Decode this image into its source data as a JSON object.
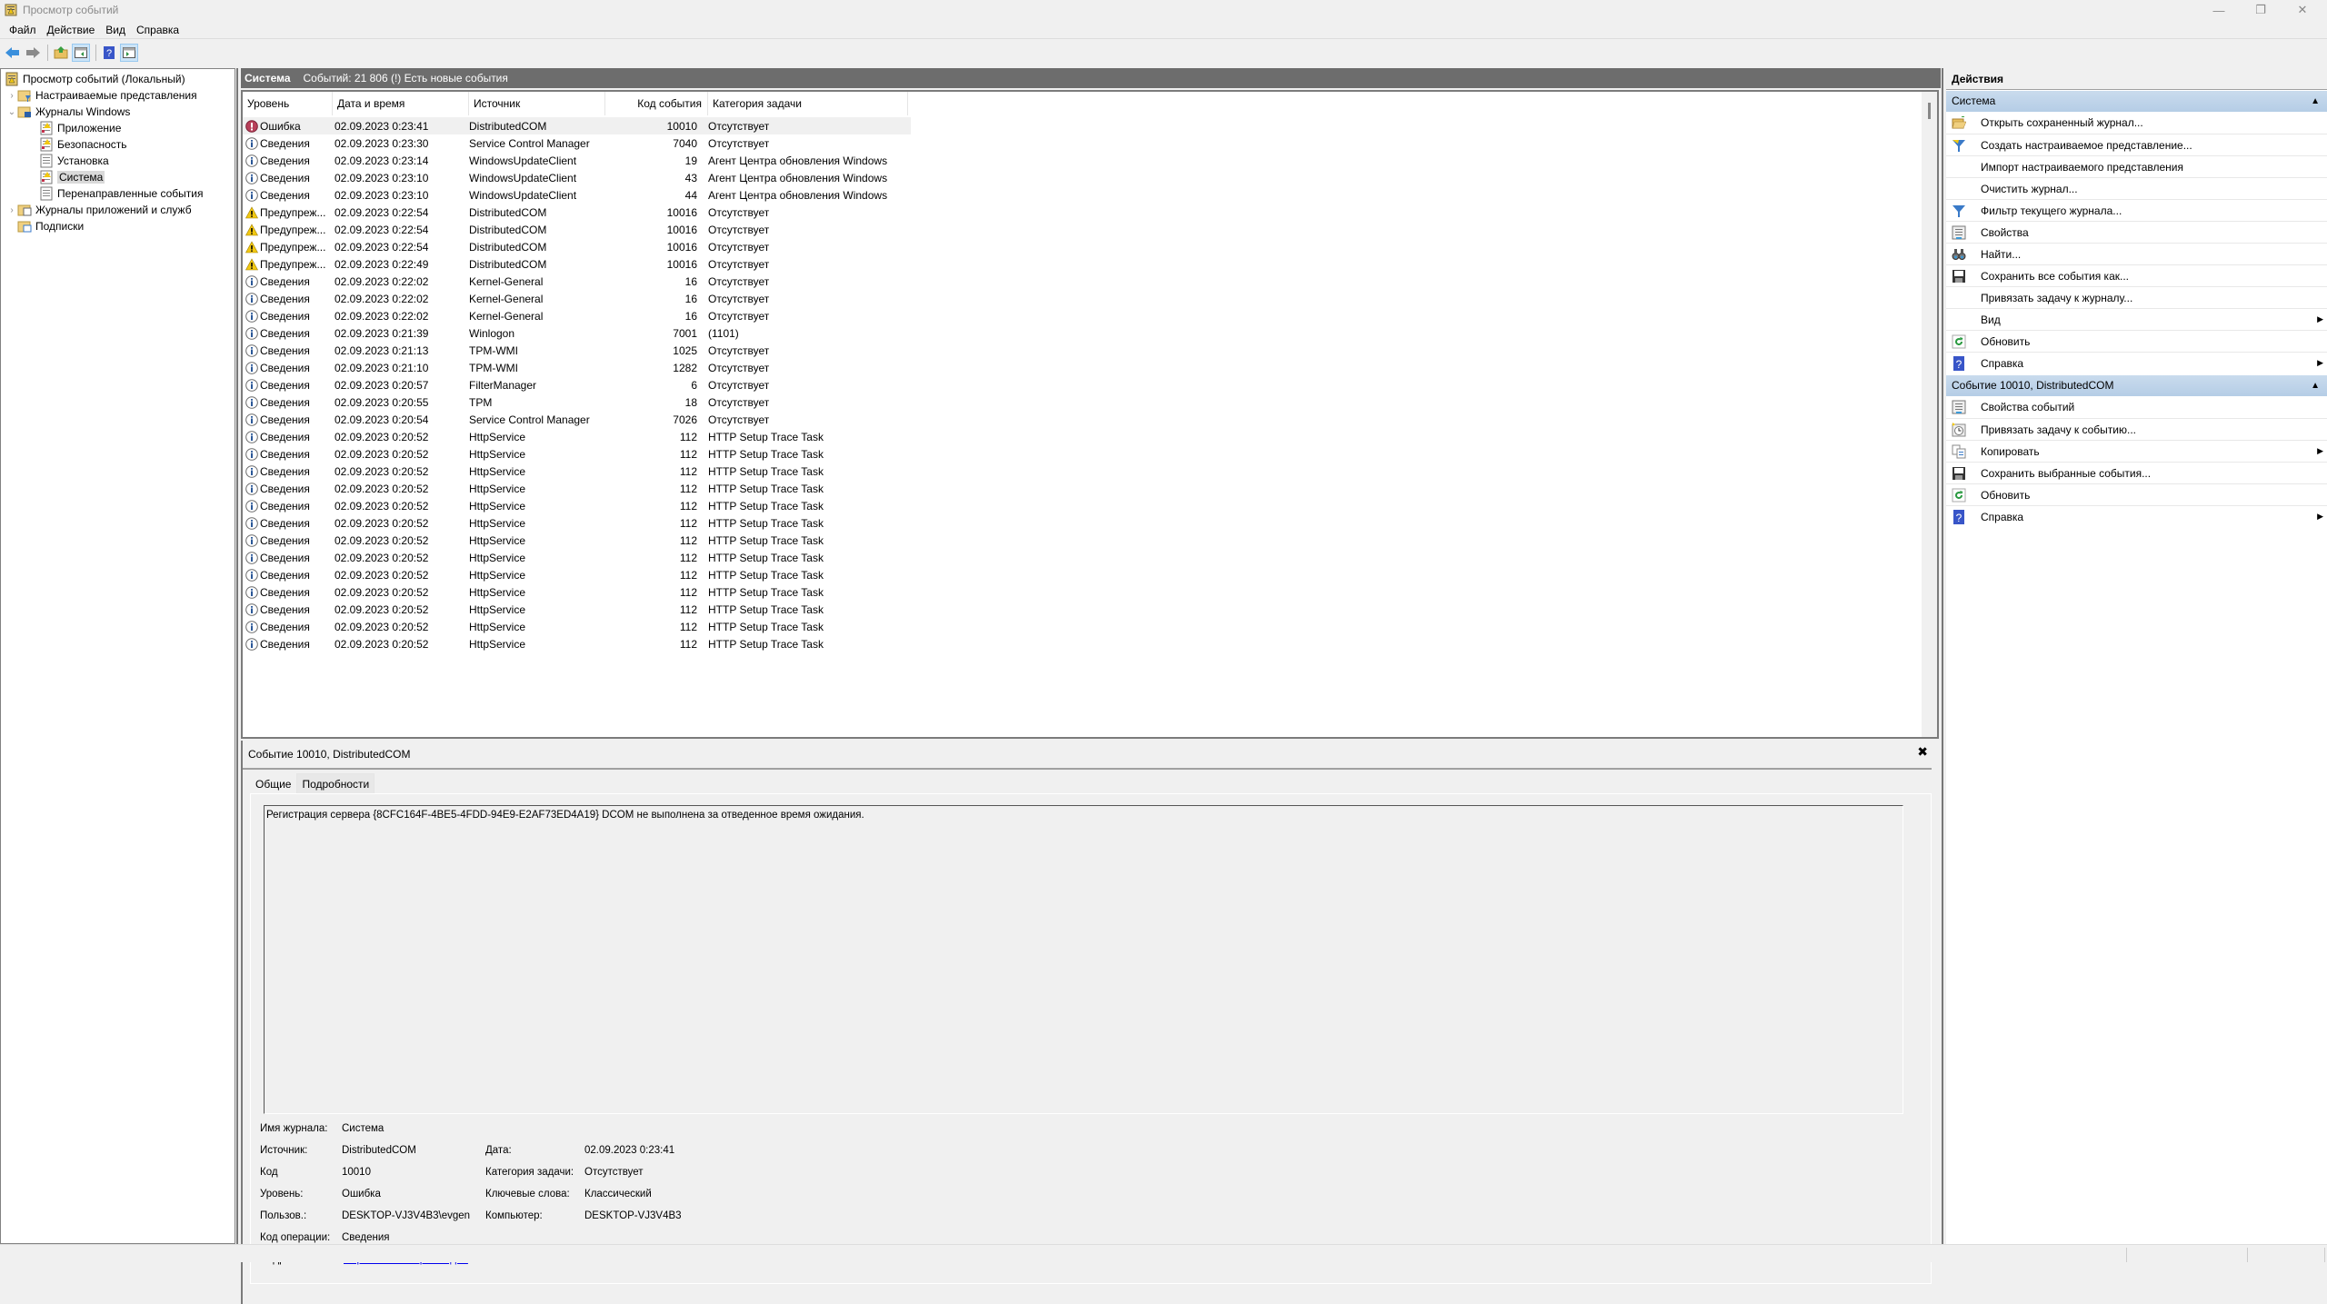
{
  "window": {
    "title": "Просмотр событий",
    "controls": {
      "minimize": "—",
      "maximize": "❐",
      "close": "✕"
    }
  },
  "menu": [
    "Файл",
    "Действие",
    "Вид",
    "Справка"
  ],
  "toolbar": {
    "buttons": [
      "back-icon",
      "forward-icon",
      "up-folder-icon",
      "show-hide-console-tree-icon",
      "help-icon",
      "show-hide-action-pane-icon"
    ]
  },
  "tree": {
    "root": "Просмотр событий (Локальный)",
    "items": [
      {
        "label": "Настраиваемые представления",
        "level": 1,
        "expander": "›"
      },
      {
        "label": "Журналы Windows",
        "level": 1,
        "expander": "⌄"
      },
      {
        "label": "Приложение",
        "level": 2
      },
      {
        "label": "Безопасность",
        "level": 2
      },
      {
        "label": "Установка",
        "level": 2
      },
      {
        "label": "Система",
        "level": 2,
        "selected": true
      },
      {
        "label": "Перенаправленные события",
        "level": 2
      },
      {
        "label": "Журналы приложений и служб",
        "level": 1,
        "expander": "›"
      },
      {
        "label": "Подписки",
        "level": 1
      }
    ]
  },
  "list": {
    "title": "Система",
    "summary": "Событий: 21 806 (!) Есть новые события",
    "columns": [
      "Уровень",
      "Дата и время",
      "Источник",
      "Код события",
      "Категория задачи"
    ],
    "rows": [
      {
        "level": "Ошибка",
        "type": "error",
        "date": "02.09.2023 0:23:41",
        "source": "DistributedCOM",
        "code": "10010",
        "category": "Отсутствует"
      },
      {
        "level": "Сведения",
        "type": "info",
        "date": "02.09.2023 0:23:30",
        "source": "Service Control Manager",
        "code": "7040",
        "category": "Отсутствует"
      },
      {
        "level": "Сведения",
        "type": "info",
        "date": "02.09.2023 0:23:14",
        "source": "WindowsUpdateClient",
        "code": "19",
        "category": "Агент Центра обновления Windows"
      },
      {
        "level": "Сведения",
        "type": "info",
        "date": "02.09.2023 0:23:10",
        "source": "WindowsUpdateClient",
        "code": "43",
        "category": "Агент Центра обновления Windows"
      },
      {
        "level": "Сведения",
        "type": "info",
        "date": "02.09.2023 0:23:10",
        "source": "WindowsUpdateClient",
        "code": "44",
        "category": "Агент Центра обновления Windows"
      },
      {
        "level": "Предупреж...",
        "type": "warning",
        "date": "02.09.2023 0:22:54",
        "source": "DistributedCOM",
        "code": "10016",
        "category": "Отсутствует"
      },
      {
        "level": "Предупреж...",
        "type": "warning",
        "date": "02.09.2023 0:22:54",
        "source": "DistributedCOM",
        "code": "10016",
        "category": "Отсутствует"
      },
      {
        "level": "Предупреж...",
        "type": "warning",
        "date": "02.09.2023 0:22:54",
        "source": "DistributedCOM",
        "code": "10016",
        "category": "Отсутствует"
      },
      {
        "level": "Предупреж...",
        "type": "warning",
        "date": "02.09.2023 0:22:49",
        "source": "DistributedCOM",
        "code": "10016",
        "category": "Отсутствует"
      },
      {
        "level": "Сведения",
        "type": "info",
        "date": "02.09.2023 0:22:02",
        "source": "Kernel-General",
        "code": "16",
        "category": "Отсутствует"
      },
      {
        "level": "Сведения",
        "type": "info",
        "date": "02.09.2023 0:22:02",
        "source": "Kernel-General",
        "code": "16",
        "category": "Отсутствует"
      },
      {
        "level": "Сведения",
        "type": "info",
        "date": "02.09.2023 0:22:02",
        "source": "Kernel-General",
        "code": "16",
        "category": "Отсутствует"
      },
      {
        "level": "Сведения",
        "type": "info",
        "date": "02.09.2023 0:21:39",
        "source": "Winlogon",
        "code": "7001",
        "category": "(1101)"
      },
      {
        "level": "Сведения",
        "type": "info",
        "date": "02.09.2023 0:21:13",
        "source": "TPM-WMI",
        "code": "1025",
        "category": "Отсутствует"
      },
      {
        "level": "Сведения",
        "type": "info",
        "date": "02.09.2023 0:21:10",
        "source": "TPM-WMI",
        "code": "1282",
        "category": "Отсутствует"
      },
      {
        "level": "Сведения",
        "type": "info",
        "date": "02.09.2023 0:20:57",
        "source": "FilterManager",
        "code": "6",
        "category": "Отсутствует"
      },
      {
        "level": "Сведения",
        "type": "info",
        "date": "02.09.2023 0:20:55",
        "source": "TPM",
        "code": "18",
        "category": "Отсутствует"
      },
      {
        "level": "Сведения",
        "type": "info",
        "date": "02.09.2023 0:20:54",
        "source": "Service Control Manager",
        "code": "7026",
        "category": "Отсутствует"
      },
      {
        "level": "Сведения",
        "type": "info",
        "date": "02.09.2023 0:20:52",
        "source": "HttpService",
        "code": "112",
        "category": "HTTP Setup Trace Task"
      },
      {
        "level": "Сведения",
        "type": "info",
        "date": "02.09.2023 0:20:52",
        "source": "HttpService",
        "code": "112",
        "category": "HTTP Setup Trace Task"
      },
      {
        "level": "Сведения",
        "type": "info",
        "date": "02.09.2023 0:20:52",
        "source": "HttpService",
        "code": "112",
        "category": "HTTP Setup Trace Task"
      },
      {
        "level": "Сведения",
        "type": "info",
        "date": "02.09.2023 0:20:52",
        "source": "HttpService",
        "code": "112",
        "category": "HTTP Setup Trace Task"
      },
      {
        "level": "Сведения",
        "type": "info",
        "date": "02.09.2023 0:20:52",
        "source": "HttpService",
        "code": "112",
        "category": "HTTP Setup Trace Task"
      },
      {
        "level": "Сведения",
        "type": "info",
        "date": "02.09.2023 0:20:52",
        "source": "HttpService",
        "code": "112",
        "category": "HTTP Setup Trace Task"
      },
      {
        "level": "Сведения",
        "type": "info",
        "date": "02.09.2023 0:20:52",
        "source": "HttpService",
        "code": "112",
        "category": "HTTP Setup Trace Task"
      },
      {
        "level": "Сведения",
        "type": "info",
        "date": "02.09.2023 0:20:52",
        "source": "HttpService",
        "code": "112",
        "category": "HTTP Setup Trace Task"
      },
      {
        "level": "Сведения",
        "type": "info",
        "date": "02.09.2023 0:20:52",
        "source": "HttpService",
        "code": "112",
        "category": "HTTP Setup Trace Task"
      },
      {
        "level": "Сведения",
        "type": "info",
        "date": "02.09.2023 0:20:52",
        "source": "HttpService",
        "code": "112",
        "category": "HTTP Setup Trace Task"
      },
      {
        "level": "Сведения",
        "type": "info",
        "date": "02.09.2023 0:20:52",
        "source": "HttpService",
        "code": "112",
        "category": "HTTP Setup Trace Task"
      },
      {
        "level": "Сведения",
        "type": "info",
        "date": "02.09.2023 0:20:52",
        "source": "HttpService",
        "code": "112",
        "category": "HTTP Setup Trace Task"
      },
      {
        "level": "Сведения",
        "type": "info",
        "date": "02.09.2023 0:20:52",
        "source": "HttpService",
        "code": "112",
        "category": "HTTP Setup Trace Task"
      }
    ]
  },
  "detail": {
    "title": "Событие 10010, DistributedCOM",
    "close": "✖",
    "tabs": [
      "Общие",
      "Подробности"
    ],
    "message": "Регистрация сервера {8CFC164F-4BE5-4FDD-94E9-E2AF73ED4A19} DCOM не выполнена за отведенное время ожидания.",
    "fields": {
      "log_name_label": "Имя журнала:",
      "log_name": "Система",
      "source_label": "Источник:",
      "source": "DistributedCOM",
      "date_label": "Дата:",
      "date": "02.09.2023 0:23:41",
      "code_label": "Код",
      "code": "10010",
      "category_label": "Категория задачи:",
      "category": "Отсутствует",
      "level_label": "Уровень:",
      "level": "Ошибка",
      "keywords_label": "Ключевые слова:",
      "keywords": "Классический",
      "user_label": "Пользов.:",
      "user": "DESKTOP-VJ3V4B3\\evgen",
      "computer_label": "Компьютер:",
      "computer": "DESKTOP-VJ3V4B3",
      "opcode_label": "Код операции:",
      "opcode": "Сведения",
      "more_label": "Подробности:",
      "more_link": "Справка в Интернете для "
    }
  },
  "actions": {
    "header": "Действия",
    "sections": [
      {
        "title": "Система",
        "items": [
          {
            "label": "Открыть сохраненный журнал...",
            "icon": "open-folder-icon"
          },
          {
            "label": "Создать настраиваемое представление...",
            "icon": "create-filter-icon"
          },
          {
            "label": "Импорт настраиваемого представления",
            "icon": ""
          },
          {
            "label": "Очистить журнал...",
            "icon": ""
          },
          {
            "label": "Фильтр текущего журнала...",
            "icon": "filter-icon"
          },
          {
            "label": "Свойства",
            "icon": "properties-icon"
          },
          {
            "label": "Найти...",
            "icon": "find-icon"
          },
          {
            "label": "Сохранить все события как...",
            "icon": "save-icon"
          },
          {
            "label": "Привязать задачу к журналу...",
            "icon": ""
          },
          {
            "label": "Вид",
            "icon": "",
            "submenu": true
          },
          {
            "label": "Обновить",
            "icon": "refresh-icon"
          },
          {
            "label": "Справка",
            "icon": "help-icon",
            "submenu": true
          }
        ]
      },
      {
        "title": "Событие 10010, DistributedCOM",
        "items": [
          {
            "label": "Свойства событий",
            "icon": "properties-icon"
          },
          {
            "label": "Привязать задачу к событию...",
            "icon": "task-icon"
          },
          {
            "label": "Копировать",
            "icon": "copy-icon",
            "submenu": true
          },
          {
            "label": "Сохранить выбранные события...",
            "icon": "save-icon"
          },
          {
            "label": "Обновить",
            "icon": "refresh-icon"
          },
          {
            "label": "Справка",
            "icon": "help-icon",
            "submenu": true
          }
        ]
      }
    ]
  },
  "colors": {
    "list_header_bg": "#6d6d6d",
    "section_header": "#bcd3ea",
    "link": "#0000ee",
    "error": "#c4314b",
    "warning": "#f2c811",
    "info": "#2b5797"
  }
}
